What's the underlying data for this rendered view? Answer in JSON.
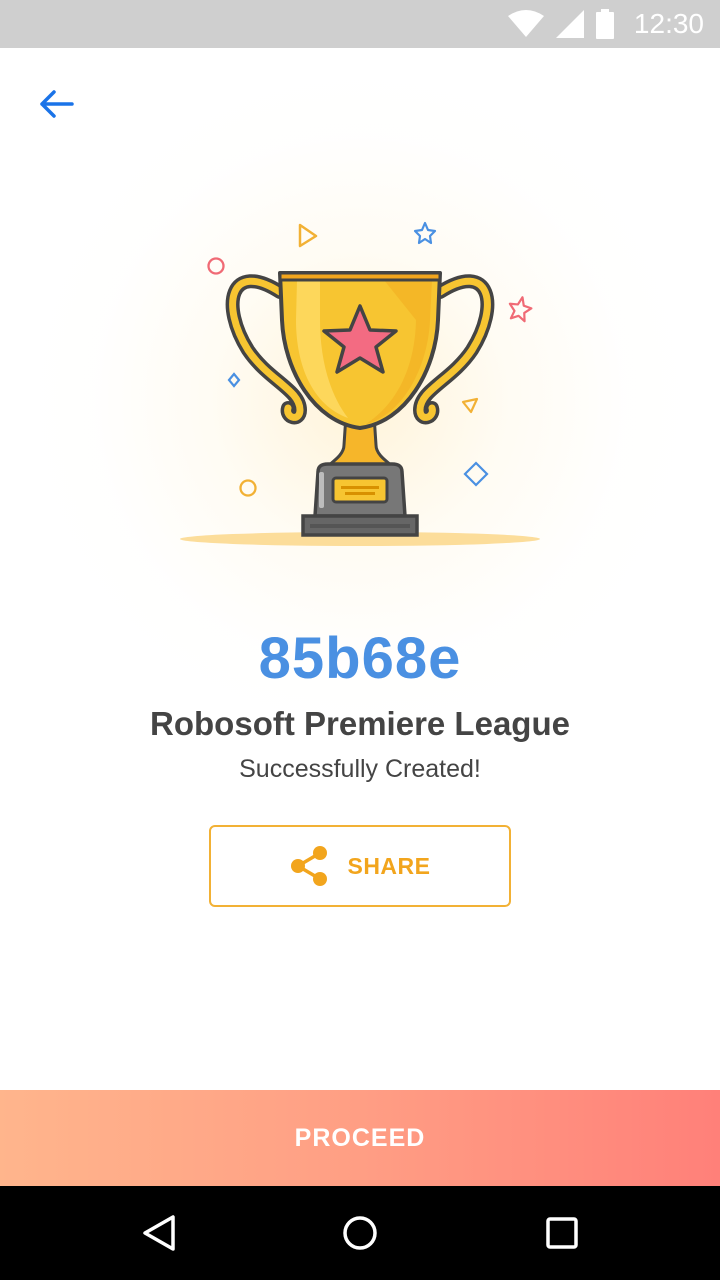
{
  "status_bar": {
    "time": "12:30",
    "icons": [
      "wifi-icon",
      "signal-icon",
      "battery-icon"
    ]
  },
  "header": {
    "back_icon": "back-arrow-icon"
  },
  "illustration": {
    "icon": "trophy-icon"
  },
  "league": {
    "code": "85b68e",
    "name": "Robosoft Premiere League",
    "message": "Successfully Created!"
  },
  "share": {
    "label": "SHARE",
    "icon": "share-icon"
  },
  "proceed": {
    "label": "PROCEED"
  },
  "nav": {
    "icons": [
      "back-triangle-icon",
      "home-circle-icon",
      "recents-square-icon"
    ]
  },
  "colors": {
    "accent_blue": "#4a90e2",
    "share_orange": "#f2a51d",
    "proceed_gradient_start": "#ffb58c",
    "proceed_gradient_end": "#ff8079",
    "trophy_gold": "#f7c531"
  }
}
